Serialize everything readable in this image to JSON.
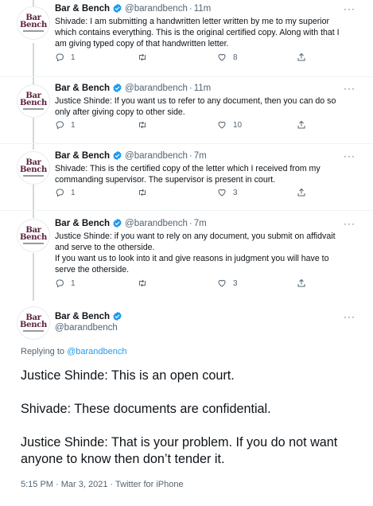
{
  "account": {
    "name": "Bar & Bench",
    "handle": "@barandbench",
    "avatar_line1": "Bar",
    "avatar_line2": "Bench",
    "verified_color": "#1d9bf0"
  },
  "thread": [
    {
      "time": "11m",
      "text": "Shivade: I am submitting a handwritten letter written by me to my superior which contains everything. This is the original certified copy. Along with that I am giving typed copy of that handwritten letter.",
      "replies": "1",
      "retweets": "",
      "likes": "8"
    },
    {
      "time": "11m",
      "text": "Justice Shinde: If you want us to refer to any document, then you can do so only after giving copy to other side.",
      "replies": "1",
      "retweets": "",
      "likes": "10"
    },
    {
      "time": "7m",
      "text": "Shivade: This is the certified copy of the letter which I received from my commanding supervisor. The supervisor is present in court.",
      "replies": "1",
      "retweets": "",
      "likes": "3"
    },
    {
      "time": "7m",
      "text_line1": "Justice Shinde: if you want to rely on any document, you submit on affidvait and serve to the otherside.",
      "text_line2": "If you want us to look into it and give reasons in judgment you will have to serve the otherside.",
      "replies": "1",
      "retweets": "",
      "likes": "3"
    }
  ],
  "main_tweet": {
    "replying_prefix": "Replying to",
    "replying_to": "@barandbench",
    "para1": "Justice Shinde: This is an open court.",
    "para2": "Shivade: These documents are confidential.",
    "para3": "Justice Shinde: That is your problem. If you do not want anyone to know then don’t tender it.",
    "meta": "5:15 PM · Mar 3, 2021 · Twitter for iPhone"
  },
  "ui": {
    "dot": "·",
    "more": "···"
  }
}
